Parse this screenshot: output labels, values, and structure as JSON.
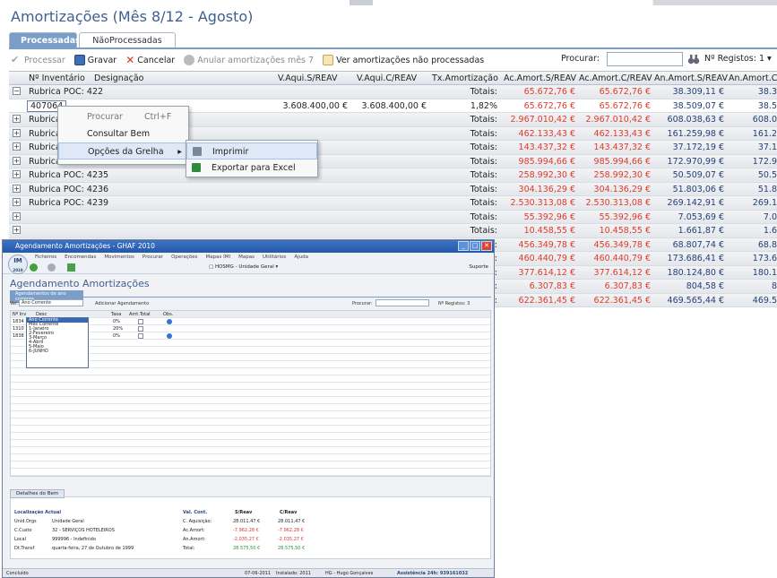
{
  "page_title": "Amortizações (Mês 8/12 - Agosto)",
  "tabs": [
    "Processadas",
    "NãoProcessadas"
  ],
  "toolbar": {
    "processar": "Processar",
    "gravar": "Gravar",
    "cancelar": "Cancelar",
    "anular": "Anular amortizações mês 7",
    "ver": "Ver amortizações não processadas",
    "procurar": "Procurar:",
    "registos": "Nº Registos: 1"
  },
  "columns": {
    "inventario": "Nº Inventário",
    "designacao": "Designação",
    "vaqs": "V.Aqui.S/REAV",
    "vaqc": "V.Aqui.C/REAV",
    "tx": "Tx.Amortização",
    "acs": "Ac.Amort.S/REAV",
    "acc": "Ac.Amort.C/REAV",
    "ans": "An.Amort.S/REAV",
    "anc": "An.Amort.C"
  },
  "detail_row": {
    "inventario": "407064",
    "vaqs": "3.608.400,00 €",
    "vaqc": "3.608.400,00 €",
    "tx": "1,82%",
    "acs": "65.672,76 €",
    "acc": "65.672,76 €",
    "ans": "38.509,07 €",
    "anc": "38.5"
  },
  "totais_label": "Totais:",
  "rows": [
    {
      "name": "Rubrica POC: 422",
      "acs": "65.672,76 €",
      "acc": "65.672,76 €",
      "ans": "38.309,11 €",
      "anc": "38.3"
    },
    {
      "name": "Rubrica",
      "acs": "2.967.010,42 €",
      "acc": "2.967.010,42 €",
      "ans": "608.038,63 €",
      "anc": "608.0"
    },
    {
      "name": "Rubrica",
      "acs": "462.133,43 €",
      "acc": "462.133,43 €",
      "ans": "161.259,98 €",
      "anc": "161.2"
    },
    {
      "name": "Rubrica",
      "acs": "143.437,32 €",
      "acc": "143.437,32 €",
      "ans": "37.172,19 €",
      "anc": "37.1"
    },
    {
      "name": "Rubrica POC: 4234",
      "acs": "985.994,66 €",
      "acc": "985.994,66 €",
      "ans": "172.970,99 €",
      "anc": "172.9"
    },
    {
      "name": "Rubrica POC: 4235",
      "acs": "258.992,30 €",
      "acc": "258.992,30 €",
      "ans": "50.509,07 €",
      "anc": "50.5"
    },
    {
      "name": "Rubrica POC: 4236",
      "acs": "304.136,29 €",
      "acc": "304.136,29 €",
      "ans": "51.803,06 €",
      "anc": "51.8"
    },
    {
      "name": "Rubrica POC: 4239",
      "acs": "2.530.313,08 €",
      "acc": "2.530.313,08 €",
      "ans": "269.142,91 €",
      "anc": "269.1"
    },
    {
      "name": "",
      "acs": "55.392,96 €",
      "acc": "55.392,96 €",
      "ans": "7.053,69 €",
      "anc": "7.0"
    },
    {
      "name": "",
      "acs": "10.458,55 €",
      "acc": "10.458,55 €",
      "ans": "1.661,87 €",
      "anc": "1.6"
    },
    {
      "name": "",
      "acs": "456.349,78 €",
      "acc": "456.349,78 €",
      "ans": "68.807,74 €",
      "anc": "68.8"
    },
    {
      "name": "",
      "acs": "460.440,79 €",
      "acc": "460.440,79 €",
      "ans": "173.686,41 €",
      "anc": "173.6"
    },
    {
      "name": "",
      "acs": "377.614,12 €",
      "acc": "377.614,12 €",
      "ans": "180.124,80 €",
      "anc": "180.1"
    },
    {
      "name": "",
      "acs": "6.307,83 €",
      "acc": "6.307,83 €",
      "ans": "804,58 €",
      "anc": "8"
    },
    {
      "name": "",
      "acs": "622.361,45 €",
      "acc": "622.361,45 €",
      "ans": "469.565,44 €",
      "anc": "469.5"
    }
  ],
  "context_menu": {
    "procurar": "Procurar",
    "procurar_shortcut": "Ctrl+F",
    "consultar": "Consultar Bem",
    "opcoes": "Opções da Grelha"
  },
  "submenu": {
    "imprimir": "Imprimir",
    "exportar": "Exportar para Excel"
  },
  "window": {
    "title": "Agendamento Amortizações - GHAF 2010",
    "menu": [
      "Ficheiros",
      "Encomendas",
      "Movimentos",
      "Procurar",
      "Operações",
      "Mapas IMI",
      "Mapas",
      "Utilitários",
      "Ajuda"
    ],
    "logo_top": "IM",
    "logo_bottom": "2010",
    "heading": "Agendamento Amortizações",
    "tab": "Agendamentos de ano corrente",
    "ver": "Ver:",
    "ver_value": "Ano Corrente",
    "adicionar": "Adicionar Agendamento",
    "procurar": "Procurar:",
    "registos": "Nº Registos: 3",
    "grid_headers": [
      "Nº Inv",
      "Desc",
      "Taxa",
      "Amt.Total",
      "Obs."
    ],
    "grid_rows": [
      {
        "inv": "1834",
        "taxa": "0%"
      },
      {
        "inv": "1310",
        "taxa": "20%"
      },
      {
        "inv": "1838",
        "taxa": "0%"
      }
    ],
    "dropdown": [
      "Ano Corrente",
      "Mês Corrente",
      "1-Janeiro",
      "2-Fevereiro",
      "3-Março",
      "4-Abril",
      "5-Maio",
      "6-JUNHO"
    ],
    "detail_tab": "Detalhes do Bem",
    "loc_title": "Localização Actual",
    "loc": [
      {
        "k": "Unid.Orgs",
        "v": "Unidade Geral"
      },
      {
        "k": "C.Custo",
        "v": "32 - SERVIÇOS HOTELEIROS"
      },
      {
        "k": "Local",
        "v": "999996 - Indefinido"
      },
      {
        "k": "Dt.Transf",
        "v": "quarta-feira, 27 de Outubro de 1999"
      }
    ],
    "val_title": "Val. Cont.",
    "val_hs": "S/Reav",
    "val_hc": "C/Reav",
    "val": [
      {
        "k": "C. Aquisição:",
        "s": "28.011,47 €",
        "c": "28.011,47 €"
      },
      {
        "k": "Ac.Amort:",
        "s": "-7.962,28 €",
        "c": "-7.962,28 €"
      },
      {
        "k": "An.Amort:",
        "s": "-2.035,27 €",
        "c": "-2.035,27 €"
      },
      {
        "k": "Total:",
        "s": "28.575,50 €",
        "c": "28.575,50 €"
      }
    ],
    "status_left": "Concluído",
    "status_mid": "07-06-2011",
    "status_inst": "Instalado: 2011",
    "status_user": "HG - Hugo Gonçalves",
    "status_right": "Assistência 24h: 939161032"
  }
}
